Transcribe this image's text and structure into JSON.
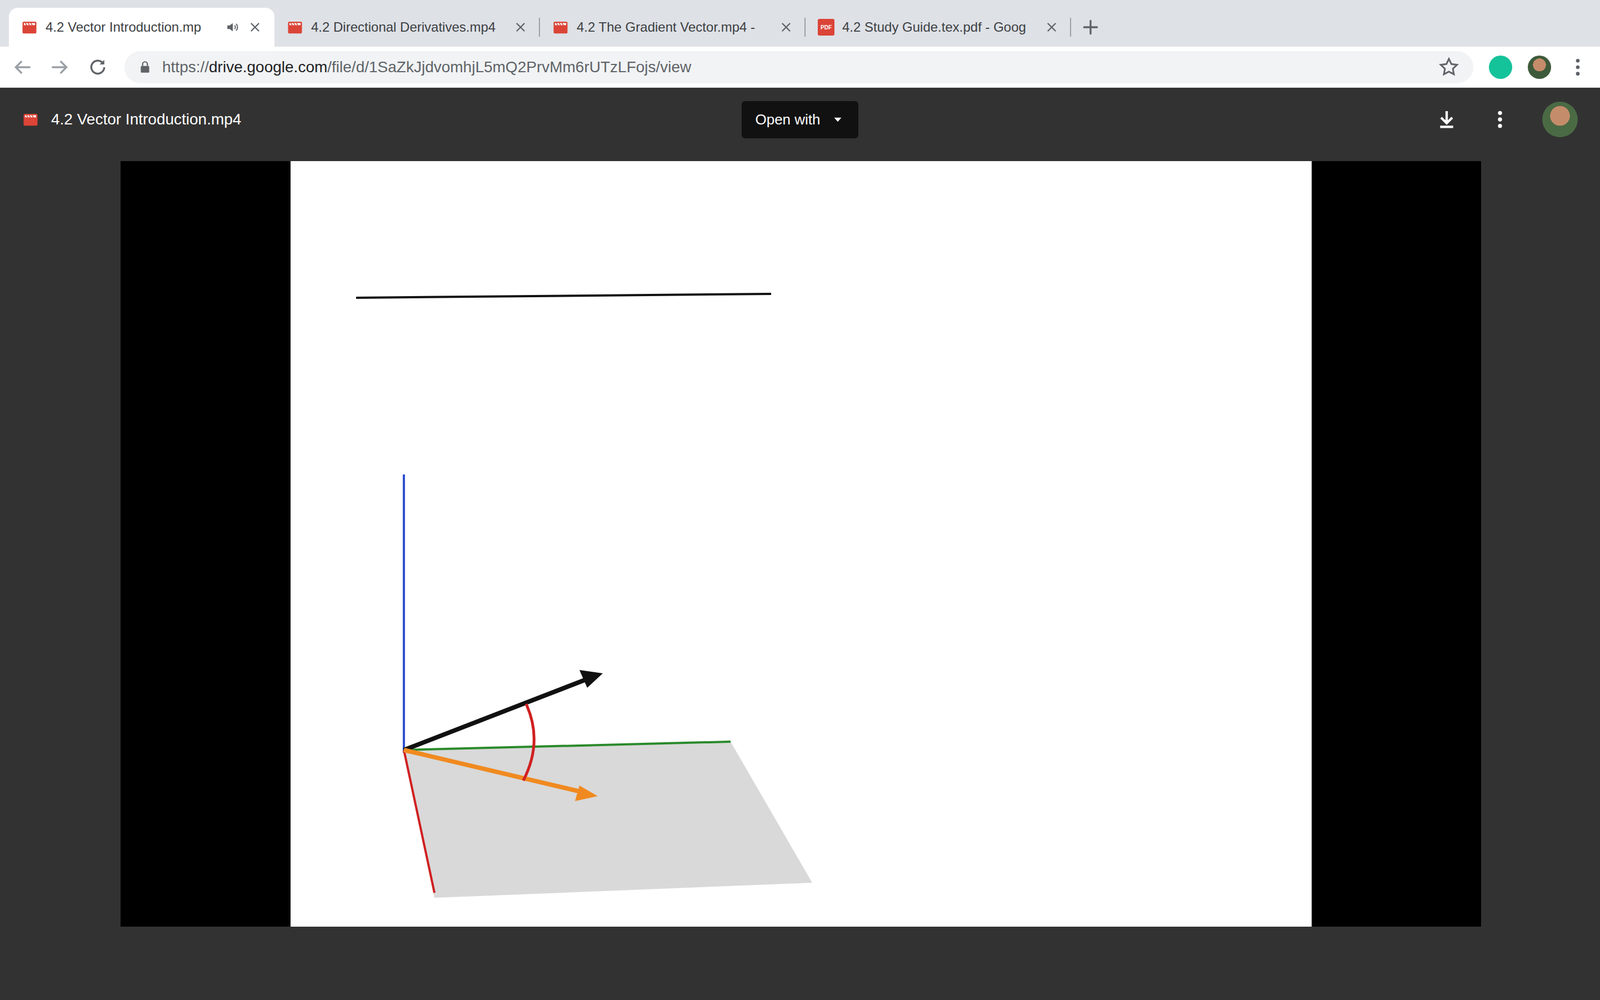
{
  "tabs": [
    {
      "label": "4.2 Vector Introduction.mp",
      "kind": "video",
      "selected": true,
      "audible": true
    },
    {
      "label": "4.2 Directional Derivatives.mp4",
      "kind": "video",
      "selected": false,
      "audible": false
    },
    {
      "label": "4.2 The Gradient Vector.mp4 -",
      "kind": "video",
      "selected": false,
      "audible": false
    },
    {
      "label": "4.2 Study Guide.tex.pdf - Goog",
      "kind": "pdf",
      "badge": "PDF",
      "selected": false,
      "audible": false
    }
  ],
  "address_bar": {
    "scheme": "https://",
    "host": "drive.google.com",
    "path": "/file/d/1SaZkJjdvomhjL5mQ2PrvMm6rUTzLFojs/view",
    "bookmarked": false
  },
  "viewer": {
    "file_name": "4.2 Vector Introduction.mp4",
    "open_with": "Open with"
  }
}
